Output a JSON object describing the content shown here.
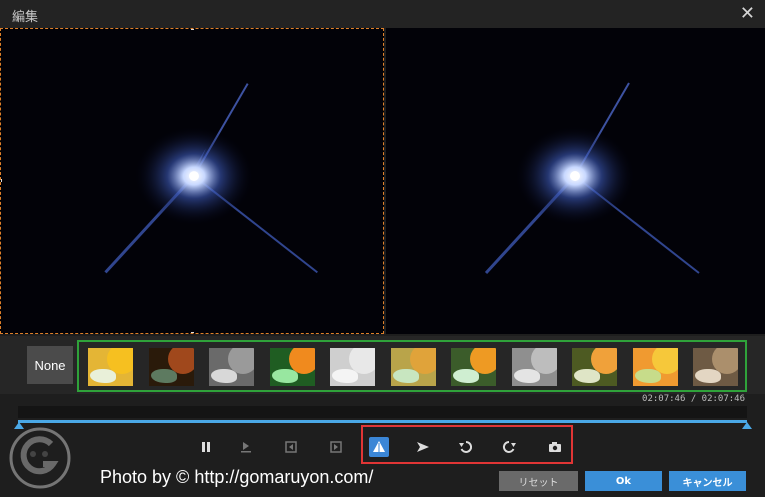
{
  "window": {
    "title": "編集"
  },
  "filters": {
    "none_label": "None",
    "thumbnails": [
      {
        "name": "original",
        "bg": "#e4b535",
        "petal": "#f6c020",
        "leaf": "#e9f0d9"
      },
      {
        "name": "dark",
        "bg": "#2a1a0a",
        "petal": "#a0481c",
        "leaf": "#5d7a60"
      },
      {
        "name": "grayscale",
        "bg": "#6a6a6a",
        "petal": "#9a9a9a",
        "leaf": "#d8d8d8"
      },
      {
        "name": "green-tint",
        "bg": "#1f5d22",
        "petal": "#f08a1e",
        "leaf": "#98e7a0"
      },
      {
        "name": "sketch",
        "bg": "#cfcfcf",
        "petal": "#e8e8e8",
        "leaf": "#f4f4f4"
      },
      {
        "name": "soft-blur",
        "bg": "#b9a44a",
        "petal": "#e0a33a",
        "leaf": "#c8e6c0"
      },
      {
        "name": "vivid",
        "bg": "#3b5c2a",
        "petal": "#ee9a23",
        "leaf": "#cfeed1"
      },
      {
        "name": "emboss",
        "bg": "#8f8f8f",
        "petal": "#bdbdbd",
        "leaf": "#e4e4e4"
      },
      {
        "name": "posterize",
        "bg": "#4d5a22",
        "petal": "#f0a13a",
        "leaf": "#dfe5c6"
      },
      {
        "name": "mosaic",
        "bg": "#f09a30",
        "petal": "#f6c83a",
        "leaf": "#c7dc8a"
      },
      {
        "name": "sepia",
        "bg": "#6e5a44",
        "petal": "#ab8f6c",
        "leaf": "#e3d6c3"
      }
    ]
  },
  "playback": {
    "time": "02:07:46 / 02:07:46",
    "progress_fraction": 1.0
  },
  "controls": [
    {
      "name": "pause-button",
      "icon": "pause-icon",
      "active": false
    },
    {
      "name": "step-forward-button",
      "icon": "step-forward-icon",
      "active": false
    },
    {
      "name": "prev-frame-button",
      "icon": "prev-frame-icon",
      "active": false
    },
    {
      "name": "next-frame-button",
      "icon": "next-frame-icon",
      "active": false
    },
    {
      "name": "flip-horizontal-button",
      "icon": "flip-horizontal-icon",
      "active": true
    },
    {
      "name": "flip-vertical-button",
      "icon": "flip-vertical-icon",
      "active": false
    },
    {
      "name": "rotate-left-button",
      "icon": "rotate-left-icon",
      "active": false
    },
    {
      "name": "rotate-right-button",
      "icon": "rotate-right-icon",
      "active": false
    },
    {
      "name": "snapshot-button",
      "icon": "camera-icon",
      "active": false
    }
  ],
  "watermark": {
    "text": "Photo by © http://gomaruyon.com/"
  },
  "buttons": {
    "reset": "リセット",
    "ok": "Ok",
    "cancel": "キャンセル"
  },
  "colors": {
    "accent": "#3a8fd8",
    "filter_box": "#2fa23a",
    "control_box": "#e03535",
    "crop_border": "#e0802a"
  }
}
